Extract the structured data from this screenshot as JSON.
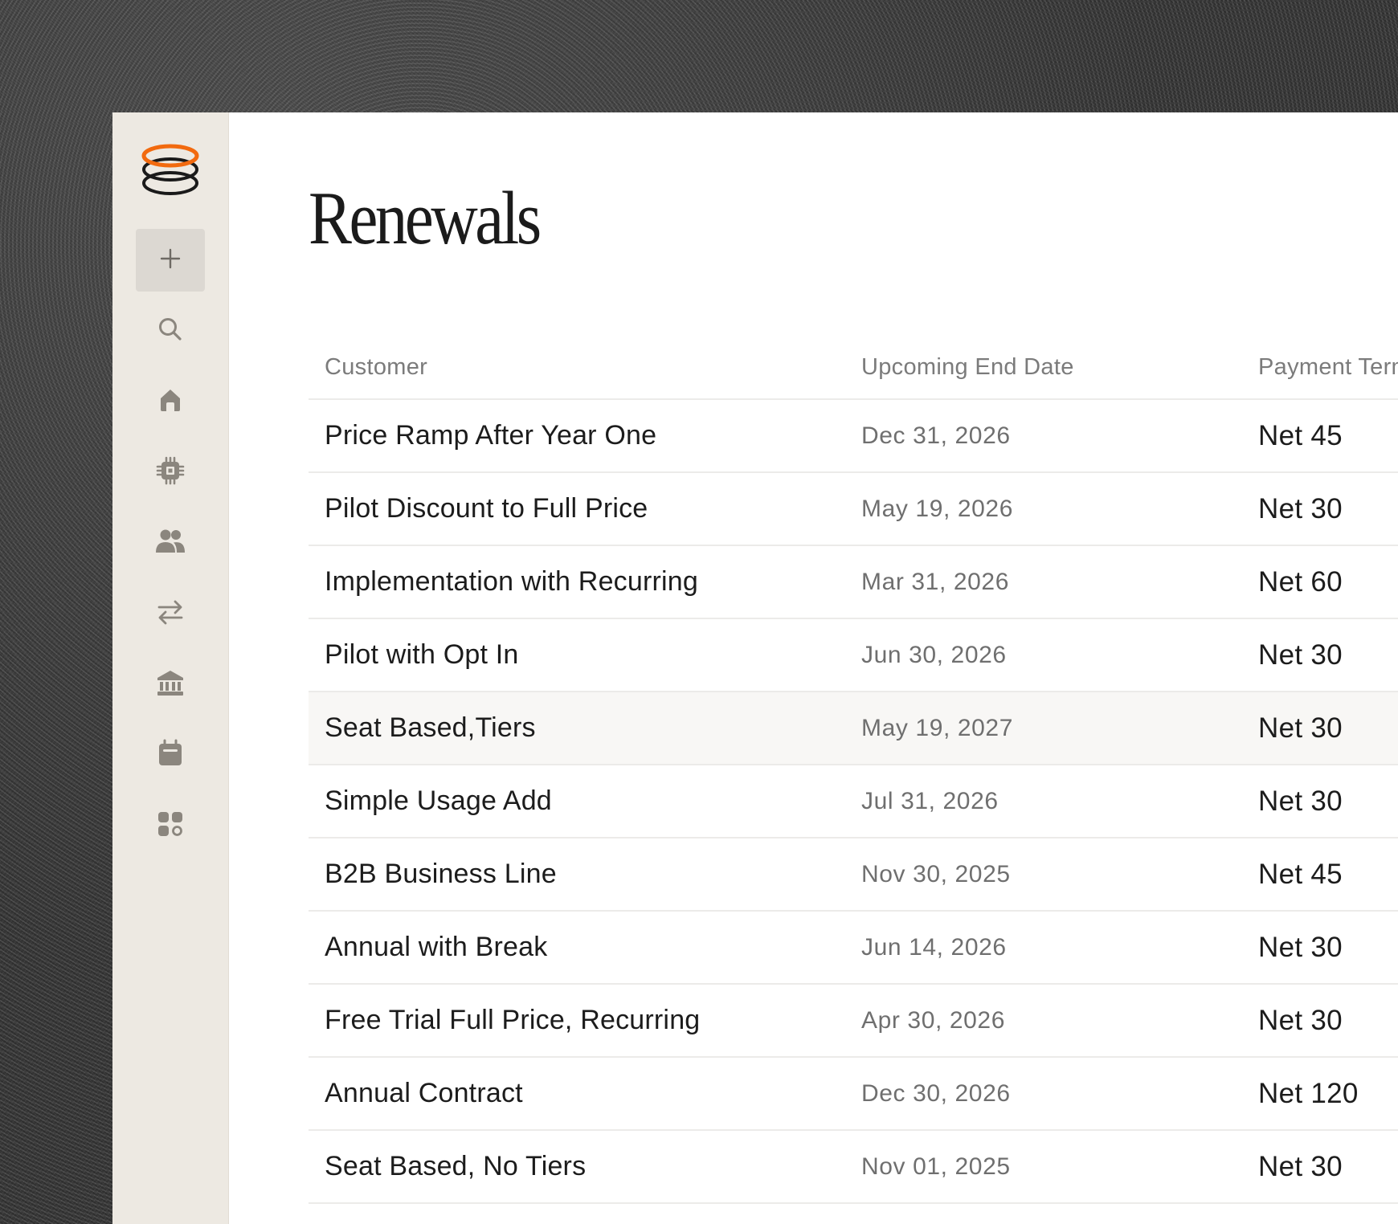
{
  "app": {
    "page_title": "Renewals",
    "accent_color": "#f26a0f"
  },
  "sidebar": {
    "logo_icon": "stacked-rings-logo",
    "new_button_icon": "plus-icon",
    "items": [
      {
        "icon": "search-icon"
      },
      {
        "icon": "home-icon"
      },
      {
        "icon": "chip-icon"
      },
      {
        "icon": "users-icon"
      },
      {
        "icon": "transfer-arrows-icon"
      },
      {
        "icon": "bank-icon"
      },
      {
        "icon": "calendar-icon"
      },
      {
        "icon": "apps-grid-icon"
      }
    ]
  },
  "table": {
    "columns": {
      "customer": "Customer",
      "end_date": "Upcoming End Date",
      "payment_terms": "Payment Terms"
    },
    "rows": [
      {
        "customer": "Price Ramp After Year One",
        "end_date": "Dec 31, 2026",
        "payment_terms": "Net 45"
      },
      {
        "customer": "Pilot Discount to Full Price",
        "end_date": "May 19, 2026",
        "payment_terms": "Net 30"
      },
      {
        "customer": "Implementation with Recurring",
        "end_date": "Mar 31, 2026",
        "payment_terms": "Net 60"
      },
      {
        "customer": "Pilot with Opt In",
        "end_date": "Jun 30, 2026",
        "payment_terms": "Net 30"
      },
      {
        "customer": "Seat Based,Tiers",
        "end_date": "May 19, 2027",
        "payment_terms": "Net 30"
      },
      {
        "customer": "Simple Usage Add",
        "end_date": "Jul 31, 2026",
        "payment_terms": "Net 30"
      },
      {
        "customer": "B2B Business Line",
        "end_date": "Nov 30, 2025",
        "payment_terms": "Net 45"
      },
      {
        "customer": "Annual with Break",
        "end_date": "Jun 14, 2026",
        "payment_terms": "Net 30"
      },
      {
        "customer": "Free Trial Full Price, Recurring",
        "end_date": "Apr 30, 2026",
        "payment_terms": "Net 30"
      },
      {
        "customer": "Annual Contract",
        "end_date": "Dec 30, 2026",
        "payment_terms": "Net 120"
      },
      {
        "customer": "Seat Based, No Tiers",
        "end_date": "Nov 01, 2025",
        "payment_terms": "Net 30"
      }
    ]
  }
}
